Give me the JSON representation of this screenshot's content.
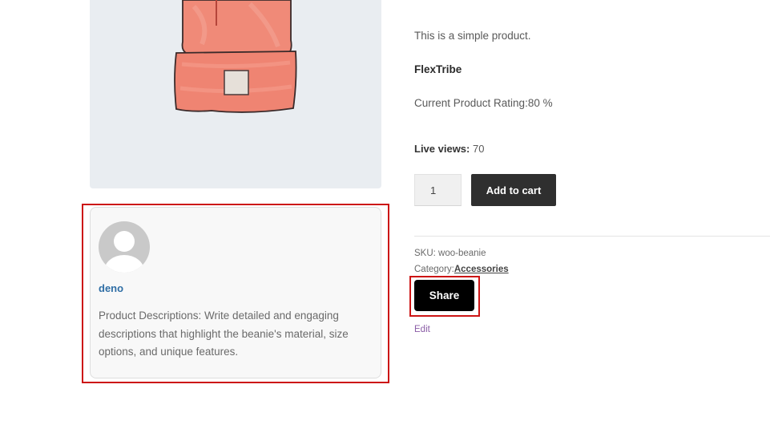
{
  "product": {
    "short_description": "This is a simple product.",
    "brand": "FlexTribe",
    "rating_text": "Current Product Rating:80 %",
    "live_views_label": "Live views:",
    "live_views_value": "70",
    "quantity": "1",
    "add_to_cart_label": "Add to cart",
    "sku_label": "SKU:",
    "sku_value": "woo-beanie",
    "category_label": "Category:",
    "category_value": "Accessories",
    "share_label": "Share",
    "edit_label": "Edit"
  },
  "author_card": {
    "name": "deno",
    "description": "Product Descriptions: Write detailed and engaging descriptions that highlight the beanie's material, size options, and unique features."
  },
  "colors": {
    "highlight": "#cc1414",
    "author_link": "#2f6ea5",
    "edit_link": "#8a5ca6",
    "beanie": "#f08a78"
  }
}
